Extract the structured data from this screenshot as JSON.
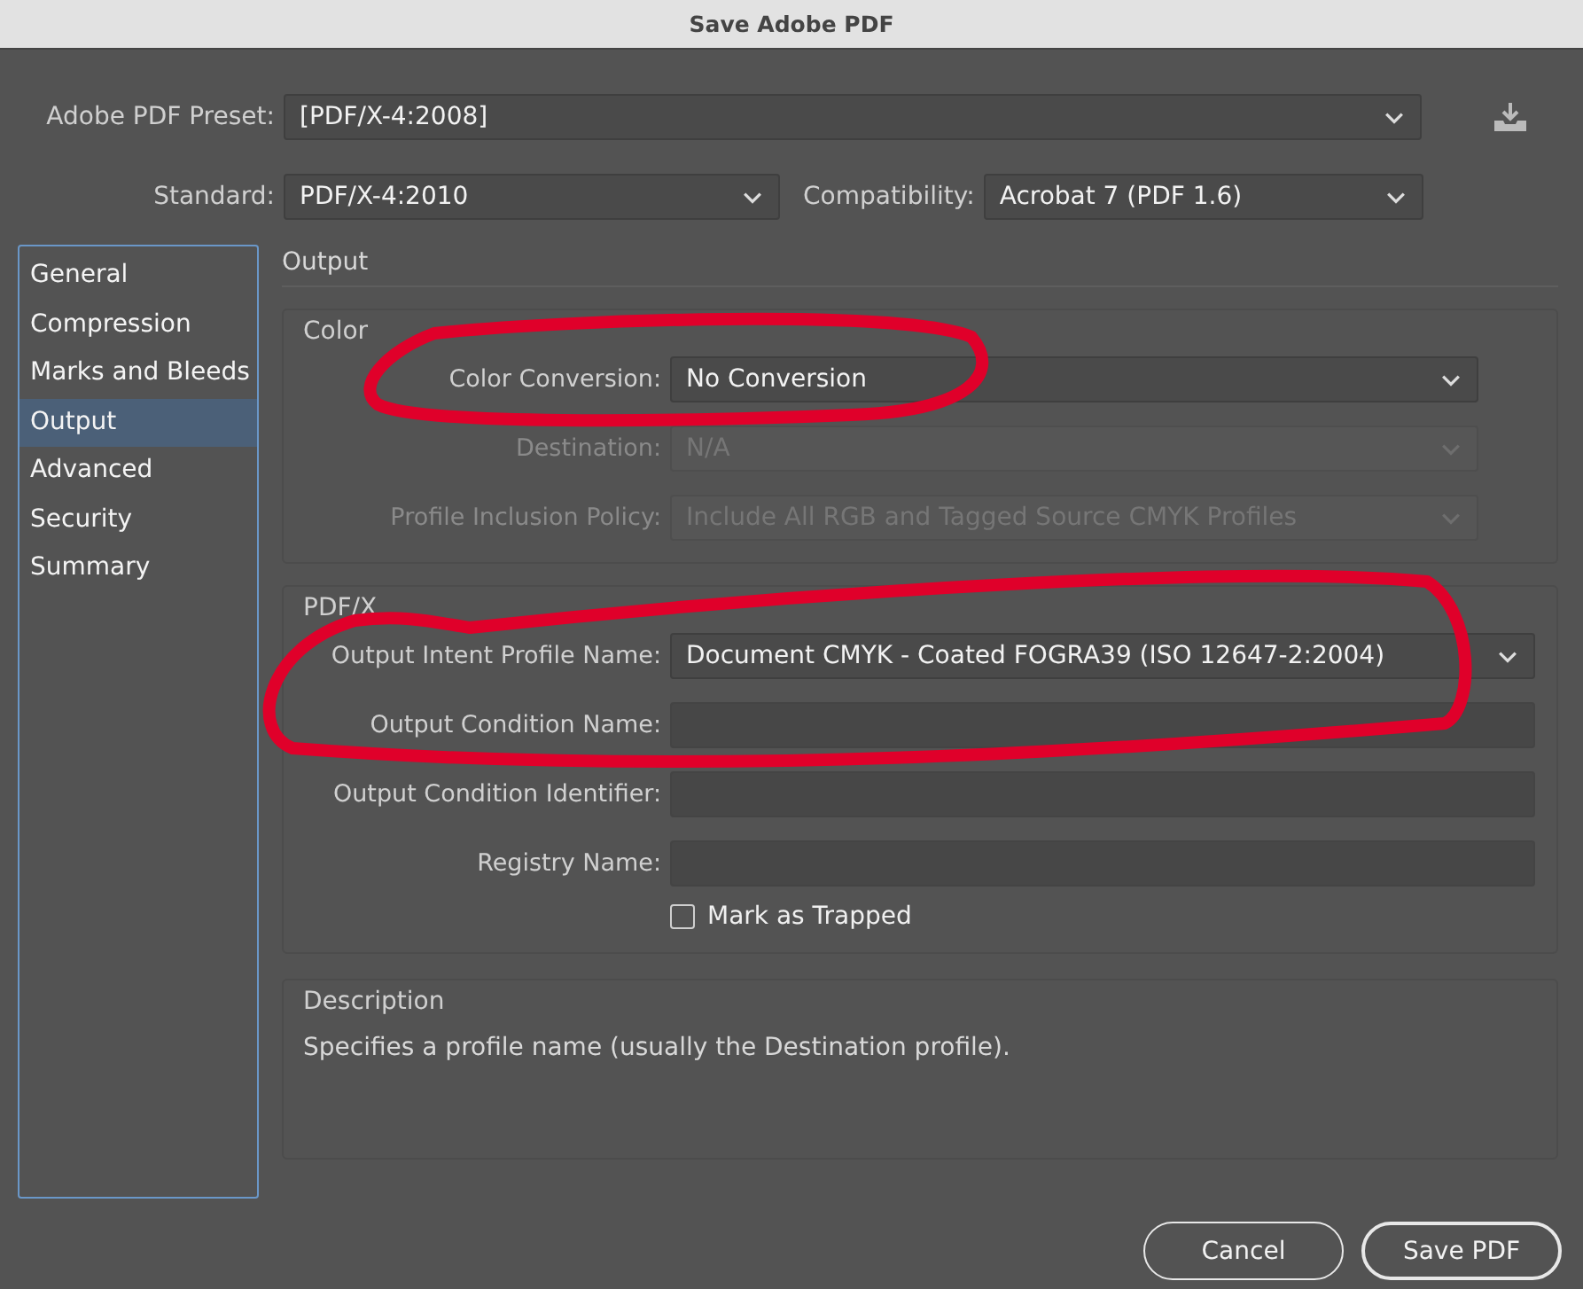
{
  "window": {
    "title": "Save Adobe PDF"
  },
  "preset": {
    "label": "Adobe PDF Preset:",
    "value": "[PDF/X-4:2008]"
  },
  "standard": {
    "label": "Standard:",
    "value": "PDF/X-4:2010"
  },
  "compatibility": {
    "label": "Compatibility:",
    "value": "Acrobat 7 (PDF 1.6)"
  },
  "sidebar": {
    "items": [
      {
        "label": "General",
        "selected": false
      },
      {
        "label": "Compression",
        "selected": false
      },
      {
        "label": "Marks and Bleeds",
        "selected": false
      },
      {
        "label": "Output",
        "selected": true
      },
      {
        "label": "Advanced",
        "selected": false
      },
      {
        "label": "Security",
        "selected": false
      },
      {
        "label": "Summary",
        "selected": false
      }
    ]
  },
  "section_title": "Output",
  "groups": [
    {
      "title": "Color",
      "fields": [
        {
          "kind": "select",
          "label": "Color Conversion:",
          "value": "No Conversion",
          "disabled": false
        },
        {
          "kind": "select",
          "label": "Destination:",
          "value": "N/A",
          "disabled": true
        },
        {
          "kind": "select",
          "label": "Profile Inclusion Policy:",
          "value": "Include All RGB and Tagged Source CMYK Profiles",
          "disabled": true
        }
      ]
    },
    {
      "title": "PDF/X",
      "fields": [
        {
          "kind": "select",
          "label": "Output Intent Profile Name:",
          "value": "Document CMYK - Coated FOGRA39 (ISO 12647-2:2004)",
          "disabled": false
        },
        {
          "kind": "text",
          "label": "Output Condition Name:",
          "disabled": false
        },
        {
          "kind": "text",
          "label": "Output Condition Identifier:",
          "disabled": false
        },
        {
          "kind": "text",
          "label": "Registry Name:",
          "disabled": false
        }
      ],
      "checkbox": {
        "label": "Mark as Trapped",
        "checked": false
      }
    }
  ],
  "description": {
    "title": "Description",
    "text": "Specifies a profile name (usually the Destination profile)."
  },
  "buttons": [
    {
      "label": "Cancel",
      "kind": "secondary"
    },
    {
      "label": "Save PDF",
      "kind": "default"
    }
  ]
}
